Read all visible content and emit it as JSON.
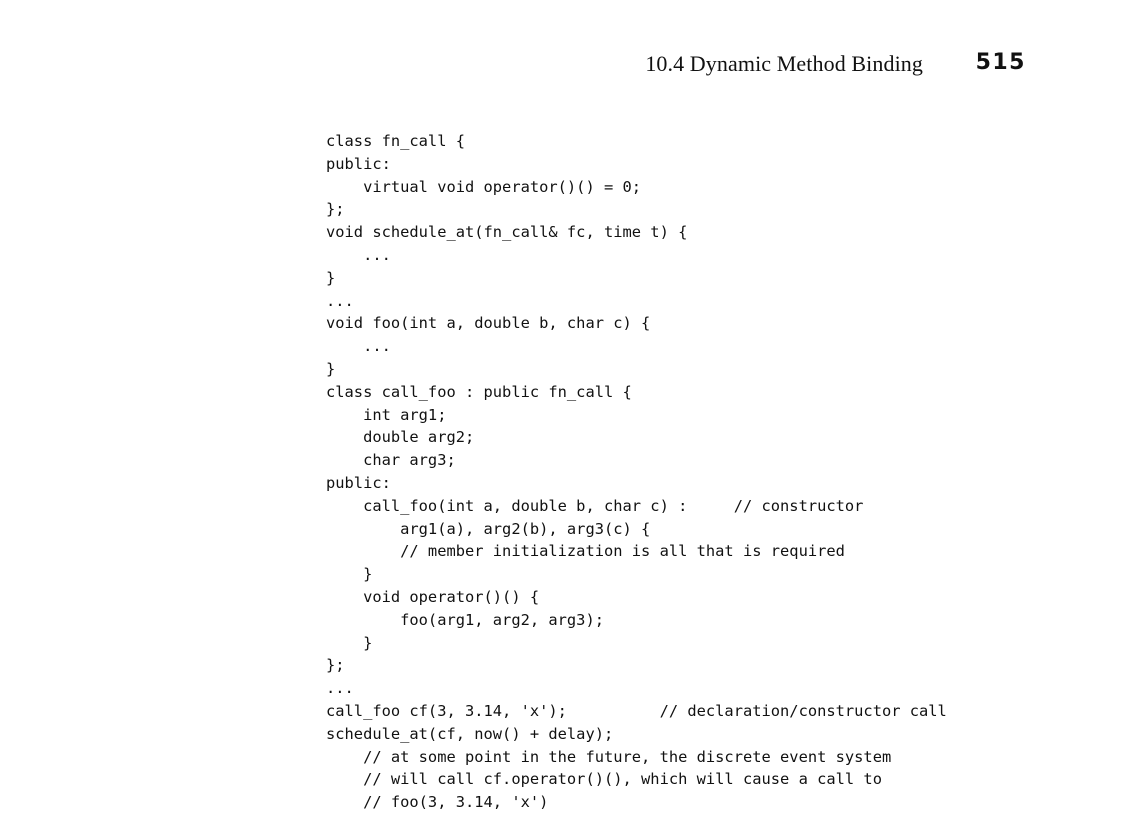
{
  "header": {
    "section_title": "10.4  Dynamic Method Binding",
    "page_number": "515"
  },
  "code_lines": [
    "class fn_call {",
    "public:",
    "    virtual void operator()() = 0;",
    "};",
    "void schedule_at(fn_call& fc, time t) {",
    "    ...",
    "}",
    "...",
    "void foo(int a, double b, char c) {",
    "    ...",
    "}",
    "class call_foo : public fn_call {",
    "    int arg1;",
    "    double arg2;",
    "    char arg3;",
    "public:",
    "    call_foo(int a, double b, char c) :     // constructor",
    "        arg1(a), arg2(b), arg3(c) {",
    "        // member initialization is all that is required",
    "    }",
    "    void operator()() {",
    "        foo(arg1, arg2, arg3);",
    "    }",
    "};",
    "...",
    "call_foo cf(3, 3.14, 'x');          // declaration/constructor call",
    "schedule_at(cf, now() + delay);",
    "    // at some point in the future, the discrete event system",
    "    // will call cf.operator()(), which will cause a call to",
    "    // foo(3, 3.14, 'x')"
  ]
}
